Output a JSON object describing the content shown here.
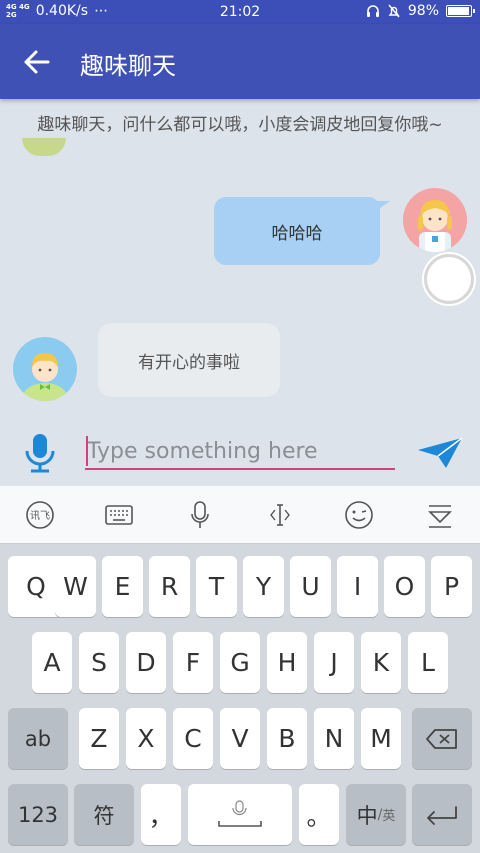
{
  "status_bar": {
    "signal_1": "4G",
    "signal_2": "4G",
    "network_type": "2G",
    "speed": "0.40K/s",
    "more": "⋯",
    "time": "21:02",
    "battery": "98%",
    "battery_level": 0.98
  },
  "app_bar": {
    "title": "趣味聊天",
    "back_icon": "arrow-back-icon"
  },
  "notice": "趣味聊天，问什么都可以哦，小度会调皮地回复你哦~",
  "messages": [
    {
      "from": "me",
      "text": "哈哈哈"
    },
    {
      "from": "bot",
      "text": "有开心的事啦"
    }
  ],
  "input": {
    "placeholder": "Type something here",
    "value": ""
  },
  "colors": {
    "app_bar": "#3f51b5",
    "status_bar": "#3c4fb8",
    "outgoing_bubble": "#a8d0f5",
    "incoming_bubble": "#e9ecef",
    "input_underline": "#d63f7f",
    "mic_and_send": "#1e88d8"
  },
  "keyboard": {
    "toolbar_icons": [
      "ime-logo-icon",
      "keyboard-icon",
      "microphone-icon",
      "text-cursor-icon",
      "emoji-icon",
      "collapse-keyboard-icon"
    ],
    "rows": [
      [
        "Q",
        "W",
        "E",
        "R",
        "T",
        "Y",
        "U",
        "I",
        "O",
        "P"
      ],
      [
        "A",
        "S",
        "D",
        "F",
        "G",
        "H",
        "J",
        "K",
        "L"
      ],
      [
        "ab",
        "Z",
        "X",
        "C",
        "V",
        "B",
        "N",
        "M",
        "backspace-icon"
      ],
      [
        "123",
        "符",
        "，",
        "space",
        "。",
        "中/英",
        "enter-icon"
      ]
    ],
    "zhong": "中",
    "ying": "英"
  }
}
